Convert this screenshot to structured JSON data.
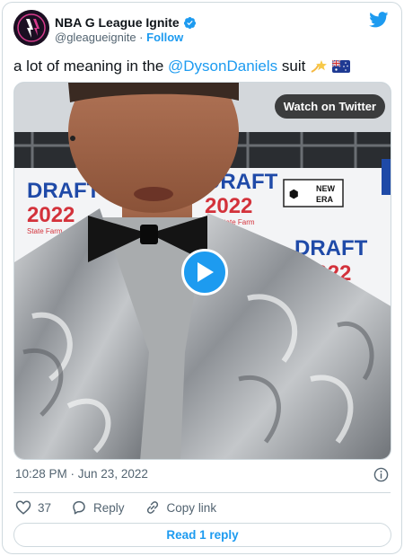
{
  "author": {
    "name": "NBA G League Ignite",
    "handle": "@gleagueignite",
    "separator": "·",
    "follow_label": "Follow"
  },
  "tweet": {
    "text_before": "a lot of meaning in the",
    "mention": "@DysonDaniels",
    "text_after": "suit",
    "emojis": [
      "dizzy-star-emoji",
      "australia-flag-emoji"
    ]
  },
  "media": {
    "watch_label": "Watch on Twitter",
    "backdrop_text": {
      "draft": "DRAFT",
      "year": "2022",
      "sponsor": "State Farm",
      "new": "NEW",
      "era": "ERA"
    }
  },
  "meta": {
    "timestamp": "10:28 PM · Jun 23, 2022"
  },
  "actions": {
    "like_count": "37",
    "reply_label": "Reply",
    "copy_link_label": "Copy link"
  },
  "read_reply_label": "Read 1 reply",
  "colors": {
    "brand_blue": "#1d9bf0",
    "text_secondary": "#536471",
    "border": "#cfd9de"
  }
}
